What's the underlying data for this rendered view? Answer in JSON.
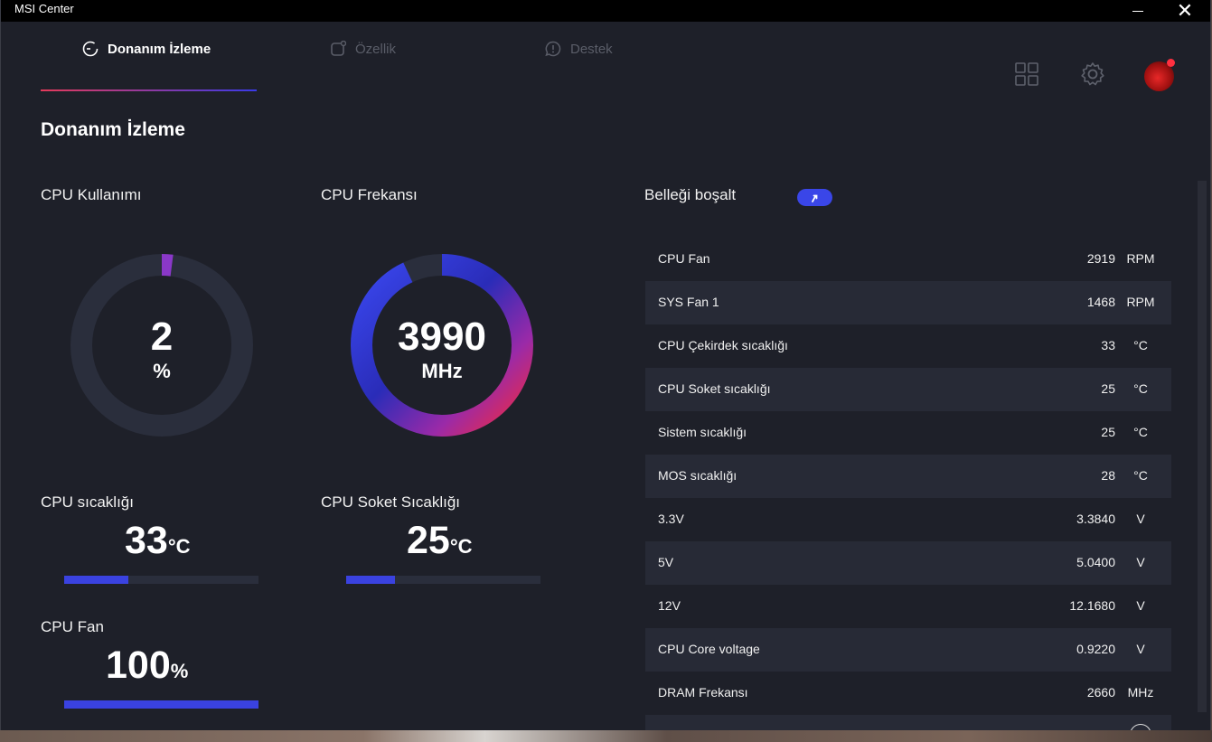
{
  "window": {
    "title": "MSI Center"
  },
  "nav": {
    "tabs": [
      {
        "label": "Donanım İzleme",
        "icon": "monitor-clock-icon",
        "active": true
      },
      {
        "label": "Özellik",
        "icon": "feature-icon",
        "active": false
      },
      {
        "label": "Destek",
        "icon": "support-chat-icon",
        "active": false
      }
    ],
    "icons": [
      "grid-icon",
      "gear-icon",
      "avatar"
    ]
  },
  "page": {
    "title": "Donanım İzleme"
  },
  "cpu_usage": {
    "label": "CPU Kullanımı",
    "value": "2",
    "unit": "%",
    "percent": 2
  },
  "cpu_freq": {
    "label": "CPU Frekansı",
    "value": "3990",
    "unit": "MHz",
    "fraction": 0.93
  },
  "cpu_temp": {
    "label": "CPU sıcaklığı",
    "value": "33",
    "unit": "°C",
    "fraction": 0.33
  },
  "cpu_socket_temp": {
    "label": "CPU Soket Sıcaklığı",
    "value": "25",
    "unit": "°C",
    "fraction": 0.25
  },
  "cpu_fan": {
    "label": "CPU Fan",
    "value": "100",
    "unit": "%",
    "fraction": 1.0
  },
  "memory": {
    "label": "Belleği boşalt",
    "button_icon": "boost-arrow-icon"
  },
  "sensors": [
    {
      "name": "CPU Fan",
      "value": "2919",
      "unit": "RPM"
    },
    {
      "name": "SYS Fan 1",
      "value": "1468",
      "unit": "RPM"
    },
    {
      "name": "CPU Çekirdek sıcaklığı",
      "value": "33",
      "unit": "°C"
    },
    {
      "name": "CPU Soket sıcaklığı",
      "value": "25",
      "unit": "°C"
    },
    {
      "name": "Sistem sıcaklığı",
      "value": "25",
      "unit": "°C"
    },
    {
      "name": "MOS sıcaklığı",
      "value": "28",
      "unit": "°C"
    },
    {
      "name": "3.3V",
      "value": "3.3840",
      "unit": "V"
    },
    {
      "name": "5V",
      "value": "5.0400",
      "unit": "V"
    },
    {
      "name": "12V",
      "value": "12.1680",
      "unit": "V"
    },
    {
      "name": "CPU Core voltage",
      "value": "0.9220",
      "unit": "V"
    },
    {
      "name": "DRAM Frekansı",
      "value": "2660",
      "unit": "MHz"
    }
  ],
  "colors": {
    "background": "#1e2029",
    "accent_blue": "#3a42e0",
    "accent_red": "#e8303e",
    "track": "#2a2e3c"
  }
}
